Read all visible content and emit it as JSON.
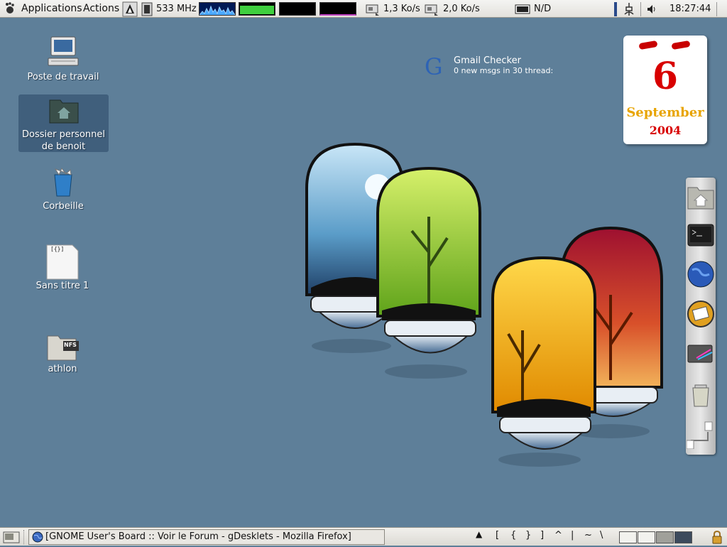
{
  "top_panel": {
    "menu_applications": "Applications",
    "menu_actions": "Actions",
    "cpu_freq": "533 MHz",
    "net_down": "1,3 Ko/s",
    "net_up": "2,0 Ko/s",
    "battery": "N/D",
    "clock": "18:27:44"
  },
  "desktop_icons": [
    {
      "label_lines": [
        "Poste de travail"
      ]
    },
    {
      "label_lines": [
        "Dossier personnel",
        "de benoit"
      ]
    },
    {
      "label_lines": [
        "Corbeille"
      ]
    },
    {
      "label_lines": [
        "Sans titre 1"
      ]
    },
    {
      "label_lines": [
        "athlon"
      ]
    }
  ],
  "document_icon_text": "[{}]",
  "nfs_badge": "NFS",
  "gmail": {
    "logo": "G",
    "title": "Gmail Checker",
    "status": "0 new msgs in 30 thread:"
  },
  "calendar": {
    "day": "6",
    "month": "September",
    "year": "2004"
  },
  "bottom_panel": {
    "task_title": "[GNOME User's Board :: Voir le Forum - gDesklets - Mozilla Firefox]",
    "key_chars": [
      "▲",
      "[",
      "{",
      "}",
      "]",
      "^",
      "|",
      "~",
      "\\"
    ]
  },
  "colors": {
    "desktop_bg": "#5e7f99",
    "panel_bg": "#e9e7e2",
    "calendar_red": "#d80000",
    "calendar_gold": "#e8a400"
  }
}
